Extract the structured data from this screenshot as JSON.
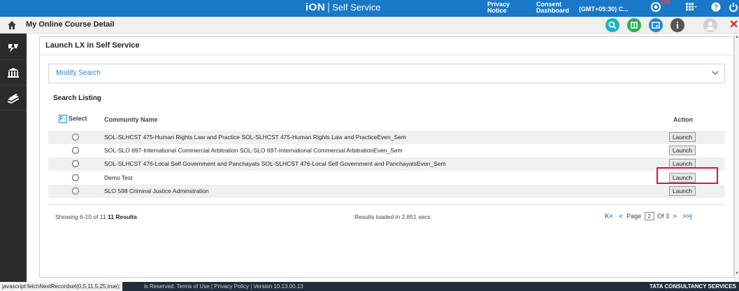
{
  "topbar": {
    "logo": "iON",
    "sep": "|",
    "app_name": "Self Service",
    "privacy_notice": "Privacy\nNotice",
    "consent_dashboard": "Consent\nDashboard",
    "timezone": "(GMT+05:30) C...",
    "notification_count": "100",
    "bg_color": "#1978c8"
  },
  "header": {
    "title": "My Online Course Detail",
    "icons": [
      "search-icon",
      "book-icon",
      "launch-icon",
      "info-icon",
      "user-icon",
      "close-icon"
    ]
  },
  "sidebar": {
    "items": [
      "course-icon",
      "institution-icon",
      "books-icon"
    ]
  },
  "panel": {
    "title": "Launch LX in Self Service",
    "modify_search": "Modify Search",
    "listing_title": "Search Listing",
    "columns": {
      "select": "Select",
      "name": "Community Name",
      "action": "Action"
    },
    "rows": [
      {
        "name": "SOL-SLHCST 475-Human Rights Law and Practice SOL-SLHCST 475-Human Rights Law and PracticeEven_Sem",
        "action": "Launch"
      },
      {
        "name": "SOL-SLO 697-International Commercial Arbitration SOL-SLO 697-International Commercial ArbitrationEven_Sem",
        "action": "Launch"
      },
      {
        "name": "SOL-SLHCST 476-Local Self Government and Panchayats SOL-SLHCST 476-Local Self Government and PanchayatsEven_Sem",
        "action": "Launch"
      },
      {
        "name": "Demo Test",
        "action": "Launch"
      },
      {
        "name": "SLO 598 Criminal Justice Adminstration",
        "action": "Launch"
      }
    ],
    "showing_prefix": "Showing 6-10 of 11",
    "showing_results": "11 Results",
    "loaded": "Results loaded in 2.851 secs",
    "pager": {
      "first": "K<",
      "prev": "<",
      "page_label": "Page",
      "current_page": "2",
      "of_label": "Of 3",
      "next": ">",
      "last": ">>|"
    }
  },
  "statusbar": {
    "js_status": "javascript:fetchNextRecordset(0,5,11,5,25,true);",
    "links": "ls Reserved.   Terms of Use | Privacy Policy | Version 10.13.00.13",
    "company": "TATA CONSULTANCY SERVICES"
  }
}
